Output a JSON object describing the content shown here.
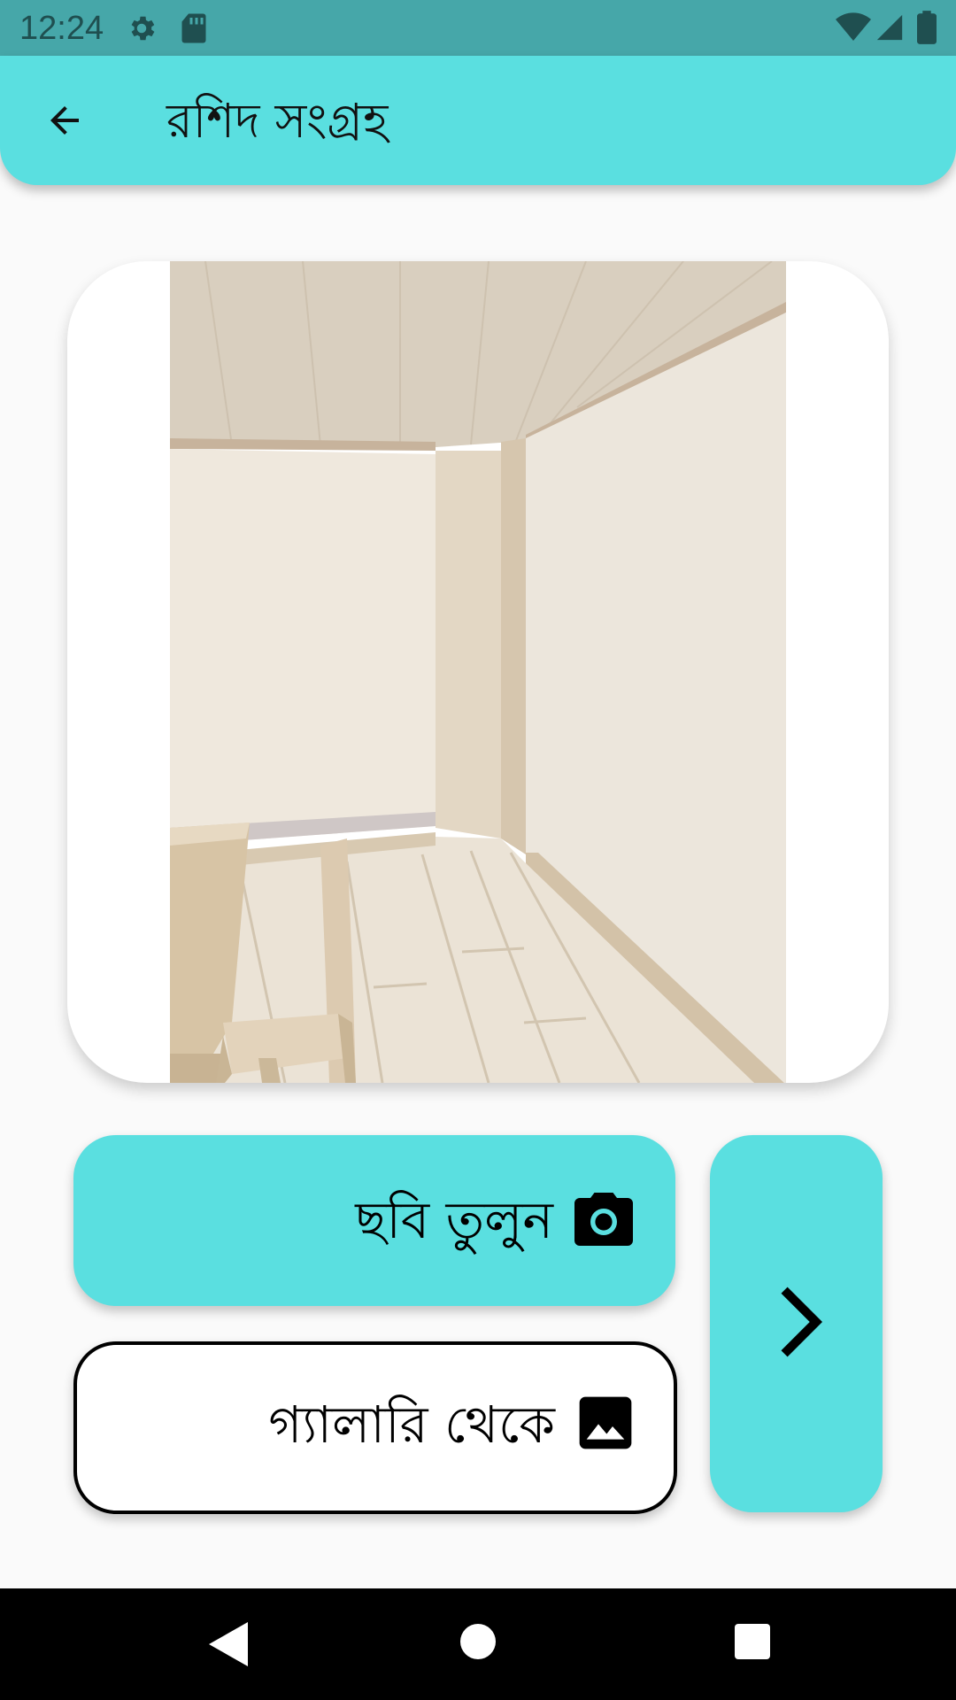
{
  "status_bar": {
    "time": "12:24",
    "icons": [
      "gear-icon",
      "sd-card-icon",
      "wifi-icon",
      "cell-signal-icon",
      "battery-icon"
    ]
  },
  "app_bar": {
    "back_icon": "arrow-back-icon",
    "title": "রশিদ সংগ্রহ"
  },
  "preview": {
    "image_content": "room-corner-photo"
  },
  "actions": {
    "camera_label": "ছবি তুলুন",
    "camera_icon": "camera-icon",
    "gallery_label": "গ্যালারি থেকে",
    "gallery_icon": "image-icon",
    "next_icon": "chevron-right-icon"
  },
  "nav_bar": {
    "back": "nav-back-icon",
    "home": "nav-home-icon",
    "recents": "nav-recents-icon"
  },
  "colors": {
    "accent": "#5adfe0",
    "status_bar": "#46a7a9",
    "background": "#fafafa"
  }
}
